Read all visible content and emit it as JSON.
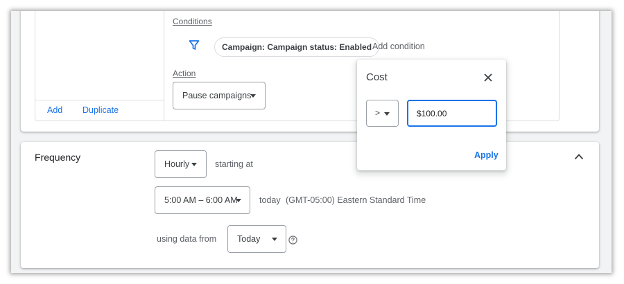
{
  "rule_editor": {
    "add_label": "Add",
    "duplicate_label": "Duplicate",
    "conditions_label": "Conditions",
    "condition_chip": "Campaign: Campaign status: Enabled",
    "add_condition_label": "Add condition",
    "action_label": "Action",
    "action_value": "Pause campaigns"
  },
  "frequency": {
    "title": "Frequency",
    "interval_value": "Hourly",
    "starting_at_label": "starting at",
    "time_range_value": "5:00 AM – 6:00 AM",
    "today_label": "today",
    "timezone_label": "(GMT-05:00) Eastern Standard Time",
    "using_data_label": "using data from",
    "data_range_value": "Today"
  },
  "cost_popup": {
    "title": "Cost",
    "operator_value": ">",
    "amount_value": "$100.00",
    "apply_label": "Apply"
  },
  "colors": {
    "accent": "#1a73e8",
    "background": "#f1f3f4",
    "card": "#ffffff",
    "border": "#dadce0"
  },
  "icons": [
    "funnel-icon",
    "close-icon",
    "chevron-down-icon",
    "chevron-up-icon",
    "help-icon"
  ]
}
